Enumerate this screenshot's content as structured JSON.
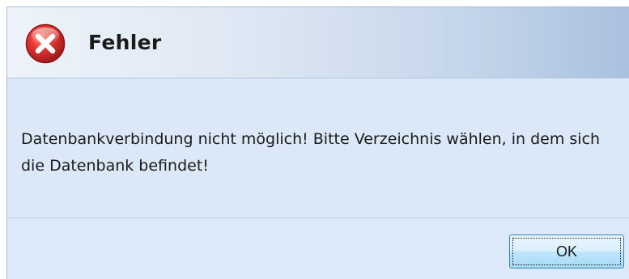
{
  "dialog": {
    "title": "Fehler",
    "icon": "error-icon",
    "message": "Datenbankverbindung nicht möglich! Bitte Verzeichnis wählen, in dem sich die Datenbank befindet!",
    "buttons": {
      "ok_label": "OK"
    }
  },
  "colors": {
    "error_red": "#d9262b",
    "header_gradient_end": "#a9c0de",
    "body_background": "#dbe8f7",
    "button_border": "#3c7fb1"
  }
}
